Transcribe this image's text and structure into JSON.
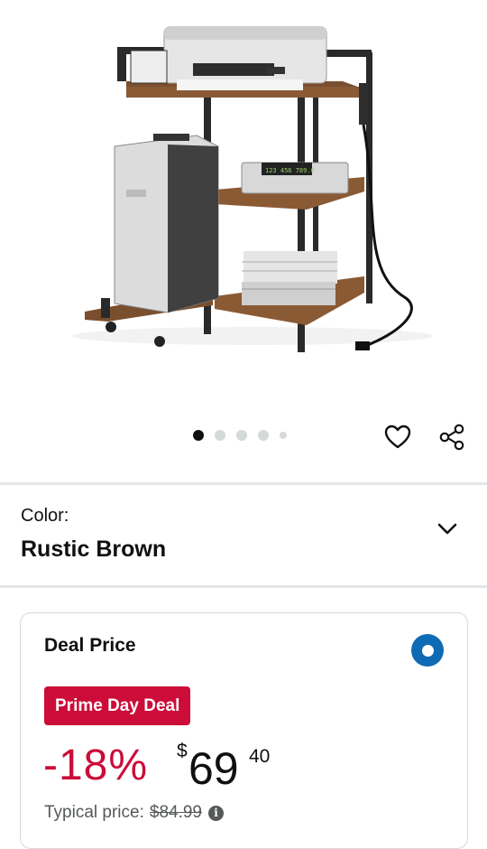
{
  "product": {
    "image_alt": "printer stand with shredder cart",
    "carousel": {
      "total": 5,
      "active_index": 0
    }
  },
  "actions": {
    "wishlist_icon": "heart-icon",
    "share_icon": "share-icon"
  },
  "color_selector": {
    "label": "Color:",
    "value": "Rustic Brown",
    "icon": "chevron-down-icon"
  },
  "deal": {
    "title": "Deal Price",
    "selected": true,
    "badge": "Prime Day Deal",
    "discount": "-18%",
    "currency": "$",
    "price_whole": "69",
    "price_fraction": "40",
    "typical_label": "Typical price:",
    "typical_price": "$84.99",
    "info_icon": "i"
  },
  "colors": {
    "deal_red": "#cc0c39",
    "radio_blue": "#0f6ab4",
    "text": "#0f1111",
    "muted": "#565959"
  }
}
